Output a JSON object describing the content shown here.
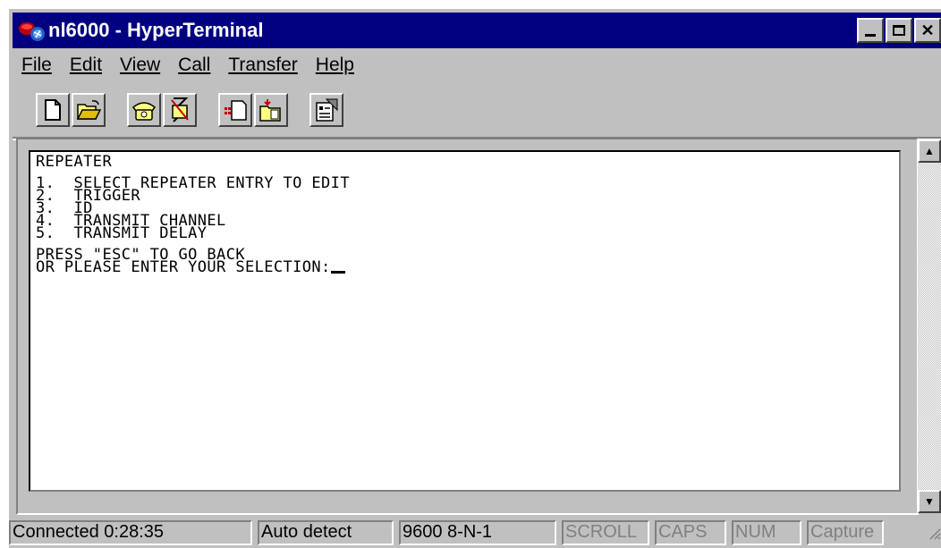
{
  "window": {
    "title": "nl6000 - HyperTerminal",
    "controls": {
      "minimize": "_",
      "maximize": "□",
      "close": "✕"
    }
  },
  "menu": [
    {
      "label": "File"
    },
    {
      "label": "Edit"
    },
    {
      "label": "View"
    },
    {
      "label": "Call"
    },
    {
      "label": "Transfer"
    },
    {
      "label": "Help"
    }
  ],
  "toolbar": {
    "buttons": [
      "new-icon",
      "open-icon",
      "connect-icon",
      "disconnect-icon",
      "send-icon",
      "receive-icon",
      "properties-icon"
    ]
  },
  "terminal": {
    "lines": [
      "REPEATER",
      "",
      "1.  SELECT REPEATER ENTRY TO EDIT",
      "2.  TRIGGER",
      "3.  ID",
      "4.  TRANSMIT CHANNEL",
      "5.  TRANSMIT DELAY",
      "",
      "PRESS \"ESC\" TO GO BACK",
      "OR PLEASE ENTER YOUR SELECTION:"
    ]
  },
  "status": {
    "connection": "Connected 0:28:35",
    "emulation": "Auto detect",
    "port": "9600 8-N-1",
    "scroll": "SCROLL",
    "caps": "CAPS",
    "num": "NUM",
    "capture": "Capture"
  }
}
